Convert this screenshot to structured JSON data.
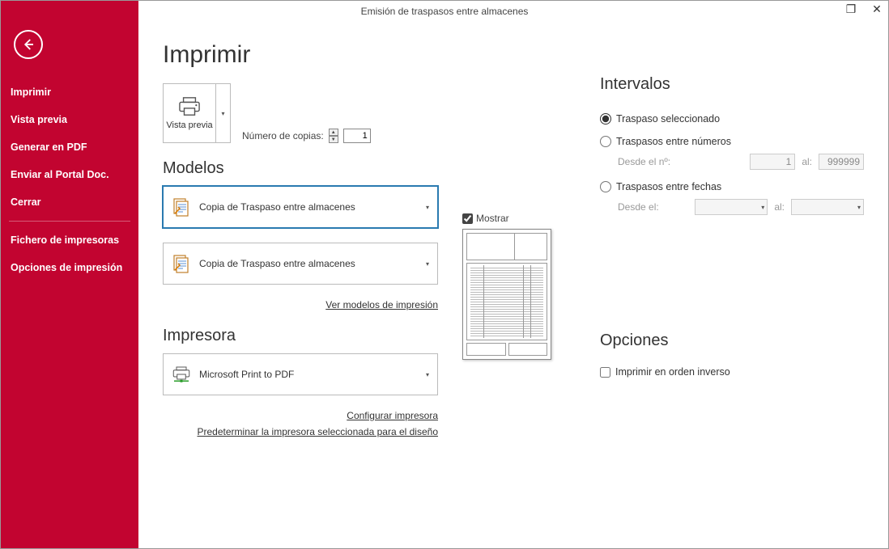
{
  "window": {
    "title": "Emisión de traspasos entre almacenes"
  },
  "sidebar": {
    "items": [
      "Imprimir",
      "Vista previa",
      "Generar en PDF",
      "Enviar al Portal Doc.",
      "Cerrar"
    ],
    "bottom": [
      "Fichero de impresoras",
      "Opciones de impresión"
    ]
  },
  "page": {
    "title": "Imprimir",
    "preview_label": "Vista previa",
    "copies_label": "Número de copias:",
    "copies_value": "1",
    "models_heading": "Modelos",
    "model1": "Copia de Traspaso entre almacenes",
    "model2": "Copia de Traspaso entre almacenes",
    "models_link": "Ver modelos de impresión",
    "printer_heading": "Impresora",
    "printer_name": "Microsoft Print to PDF",
    "printer_link1": "Configurar impresora",
    "printer_link2": "Predeterminar la impresora seleccionada para el diseño",
    "show_label": "Mostrar"
  },
  "intervals": {
    "heading": "Intervalos",
    "r1": "Traspaso seleccionado",
    "r2": "Traspasos entre números",
    "r3": "Traspasos entre fechas",
    "from_no_label": "Desde el nº:",
    "from_no_value": "1",
    "to_label": "al:",
    "to_no_value": "999999",
    "from_date_label": "Desde el:"
  },
  "options": {
    "heading": "Opciones",
    "reverse": "Imprimir en orden inverso"
  }
}
